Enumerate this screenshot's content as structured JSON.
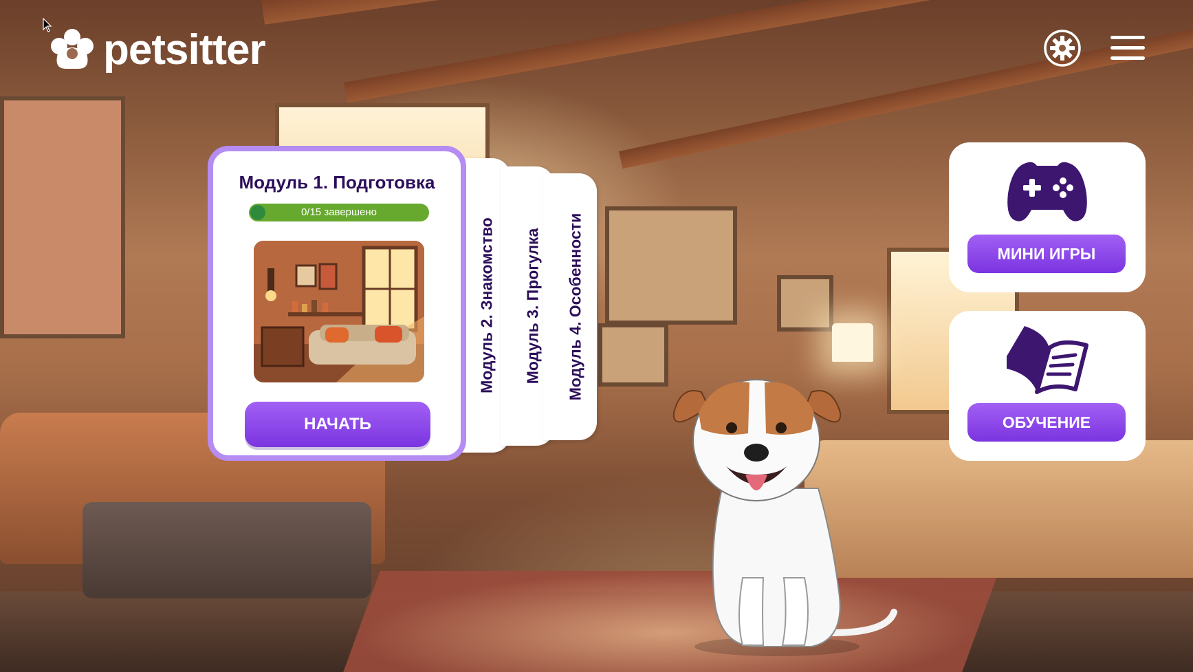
{
  "header": {
    "brand": "petsitter",
    "icons": {
      "logo": "paw-icon",
      "settings": "gear-icon",
      "menu": "hamburger-menu-icon"
    }
  },
  "current_module": {
    "title": "Модуль 1. Подготовка",
    "progress_text": "0/15 завершено",
    "progress_completed": 0,
    "progress_total": 15,
    "start_label": "НАЧАТЬ"
  },
  "modules": [
    {
      "label": "Модуль 2. Знакомство"
    },
    {
      "label": "Модуль 3. Прогулка"
    },
    {
      "label": "Модуль 4. Особенности"
    }
  ],
  "side_cards": {
    "mini_games": {
      "label": "МИНИ ИГРЫ",
      "icon": "gamepad-icon"
    },
    "learning": {
      "label": "ОБУЧЕНИЕ",
      "icon": "book-icon"
    }
  },
  "colors": {
    "accent": "#8b45ea",
    "accent_border": "#b48cf2",
    "title_text": "#2c0f5a",
    "progress": "#66a92e",
    "icon_dark": "#3d1670"
  }
}
